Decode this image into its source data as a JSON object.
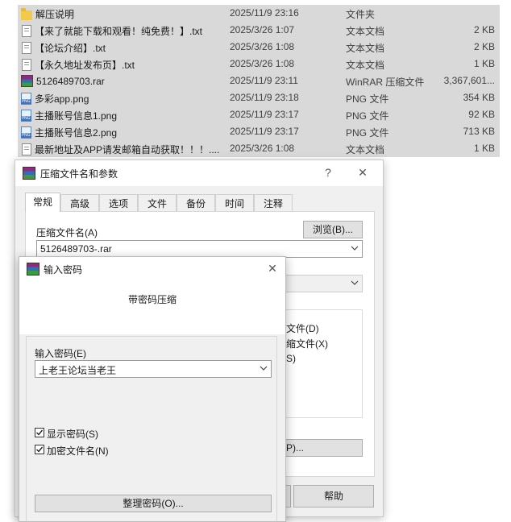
{
  "files": [
    {
      "name": "解压说明",
      "date": "2025/11/9 23:16",
      "type": "文件夹",
      "size": "",
      "icon": "folder-icon"
    },
    {
      "name": "【来了就能下载和观看！纯免费！】.txt",
      "date": "2025/3/26 1:07",
      "type": "文本文档",
      "size": "2 KB",
      "icon": "text-file-icon"
    },
    {
      "name": "【论坛介绍】.txt",
      "date": "2025/3/26 1:08",
      "type": "文本文档",
      "size": "2 KB",
      "icon": "text-file-icon"
    },
    {
      "name": "【永久地址发布页】.txt",
      "date": "2025/3/26 1:08",
      "type": "文本文档",
      "size": "1 KB",
      "icon": "text-file-icon"
    },
    {
      "name": "5126489703.rar",
      "date": "2025/11/9 23:11",
      "type": "WinRAR 压缩文件",
      "size": "3,367,601...",
      "icon": "rar-archive-icon"
    },
    {
      "name": "多彩app.png",
      "date": "2025/11/9 23:18",
      "type": "PNG 文件",
      "size": "354 KB",
      "icon": "png-file-icon"
    },
    {
      "name": "主播账号信息1.png",
      "date": "2025/11/9 23:17",
      "type": "PNG 文件",
      "size": "92 KB",
      "icon": "png-file-icon"
    },
    {
      "name": "主播账号信息2.png",
      "date": "2025/11/9 23:17",
      "type": "PNG 文件",
      "size": "713 KB",
      "icon": "png-file-icon"
    },
    {
      "name": "最新地址及APP请发邮箱自动获取！！！....",
      "date": "2025/3/26 1:08",
      "type": "文本文档",
      "size": "1 KB",
      "icon": "text-file-icon"
    }
  ],
  "archive_dialog": {
    "title": "压缩文件名和参数",
    "help_glyph": "?",
    "close_glyph": "✕",
    "tabs": [
      "常规",
      "高级",
      "选项",
      "文件",
      "备份",
      "时间",
      "注释"
    ],
    "archive_name_label": "压缩文件名(A)",
    "browse_label": "浏览(B)...",
    "archive_name_value": "5126489703-.rar",
    "partial_options": [
      "文件(D)",
      "缩文件(X)",
      "S)"
    ],
    "partial_button_label": "P)...",
    "help_button_label": "帮助"
  },
  "password_dialog": {
    "title": "输入密码",
    "close_glyph": "✕",
    "heading": "带密码压缩",
    "password_label": "输入密码(E)",
    "password_value": "上老王论坛当老王",
    "show_password_label": "显示密码(S)",
    "show_password_checked": true,
    "encrypt_names_label": "加密文件名(N)",
    "encrypt_names_checked": true,
    "organize_button_label": "整理密码(O)..."
  },
  "colors": {
    "accent": "#0078d7",
    "selection": "#d9d9d9"
  }
}
